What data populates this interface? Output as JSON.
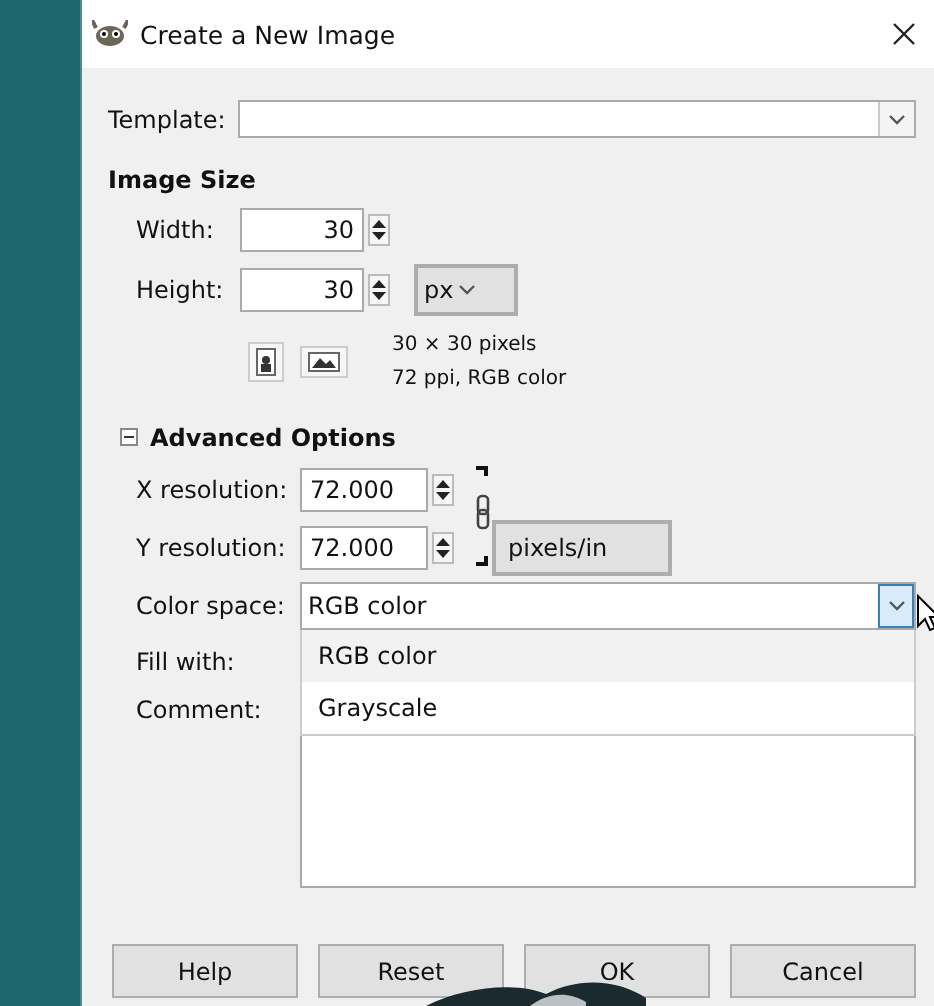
{
  "window": {
    "title": "Create a New Image"
  },
  "template": {
    "label": "Template:"
  },
  "image_size": {
    "heading": "Image Size",
    "width": {
      "label": "Width:",
      "value": "30"
    },
    "height": {
      "label": "Height:",
      "value": "30"
    },
    "unit": "px",
    "info_lines": [
      "30 × 30 pixels",
      "72 ppi, RGB color"
    ]
  },
  "advanced": {
    "label": "Advanced Options",
    "expanded": true,
    "x_resolution": {
      "label": "X resolution:",
      "value": "72.000"
    },
    "y_resolution": {
      "label": "Y resolution:",
      "value": "72.000"
    },
    "resolution_unit": "pixels/in",
    "color_space": {
      "label": "Color space:",
      "value": "RGB color",
      "open": true,
      "options": [
        {
          "label": "RGB color",
          "selected": true
        },
        {
          "label": "Grayscale",
          "selected": false
        }
      ]
    },
    "fill_with": {
      "label": "Fill with:"
    },
    "comment": {
      "label": "Comment:"
    }
  },
  "buttons": [
    "Help",
    "Reset",
    "OK",
    "Cancel"
  ]
}
